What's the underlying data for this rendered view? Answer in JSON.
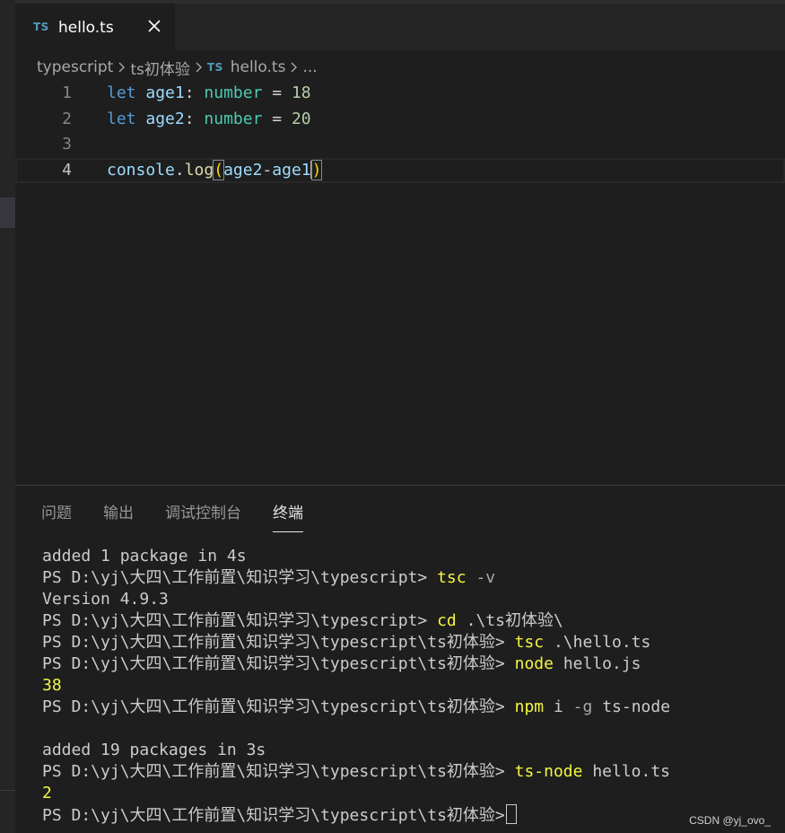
{
  "tab": {
    "badge": "TS",
    "title": "hello.ts"
  },
  "breadcrumb": {
    "items": [
      "typescript",
      "ts初体验",
      "hello.ts",
      "..."
    ],
    "badge": "TS"
  },
  "editor": {
    "lines": [
      {
        "n": "1"
      },
      {
        "n": "2"
      },
      {
        "n": "3"
      },
      {
        "n": "4"
      }
    ],
    "line1": {
      "kw": "let",
      "name": "age1",
      "colon": ":",
      "type": "number",
      "eq": "=",
      "value": "18"
    },
    "line2": {
      "kw": "let",
      "name": "age2",
      "colon": ":",
      "type": "number",
      "eq": "=",
      "value": "20"
    },
    "line4": {
      "obj": "console",
      "dot": ".",
      "fn": "log",
      "open": "(",
      "a": "age2",
      "minus": "-",
      "b": "age1",
      "close": ")"
    }
  },
  "panel": {
    "tabs": [
      "问题",
      "输出",
      "调试控制台",
      "终端"
    ],
    "active_tab": "终端"
  },
  "terminal": {
    "prompt": "PS D:\\yj\\大四\\工作前置\\知识学习\\typescript>",
    "prompt2": "PS D:\\yj\\大四\\工作前置\\知识学习\\typescript\\ts初体验>",
    "l1": "added 1 package in 4s",
    "l2_cmd": "tsc",
    "l2_flag": "-v",
    "l3": "Version 4.9.3",
    "l4_cmd": "cd",
    "l4_arg": ".\\ts初体验\\",
    "l5_cmd": "tsc",
    "l5_arg": ".\\hello.ts",
    "l6_cmd": "node",
    "l6_arg": "hello.js",
    "l7": "38",
    "l8_cmd": "npm",
    "l8_arg1": "i",
    "l8_flag": "-g",
    "l8_arg2": "ts-node",
    "l10": "added 19 packages in 3s",
    "l11_cmd": "ts-node",
    "l11_arg": "hello.ts",
    "l12": "2"
  },
  "watermark": "CSDN @yj_ovo_",
  "colors": {
    "keyword": "#569cd6",
    "variable": "#9cdcfe",
    "type": "#4ec9b0",
    "number": "#b5cea8",
    "function": "#dcdcaa",
    "terminal_command": "#f5f543",
    "ts_badge": "#519aba"
  }
}
